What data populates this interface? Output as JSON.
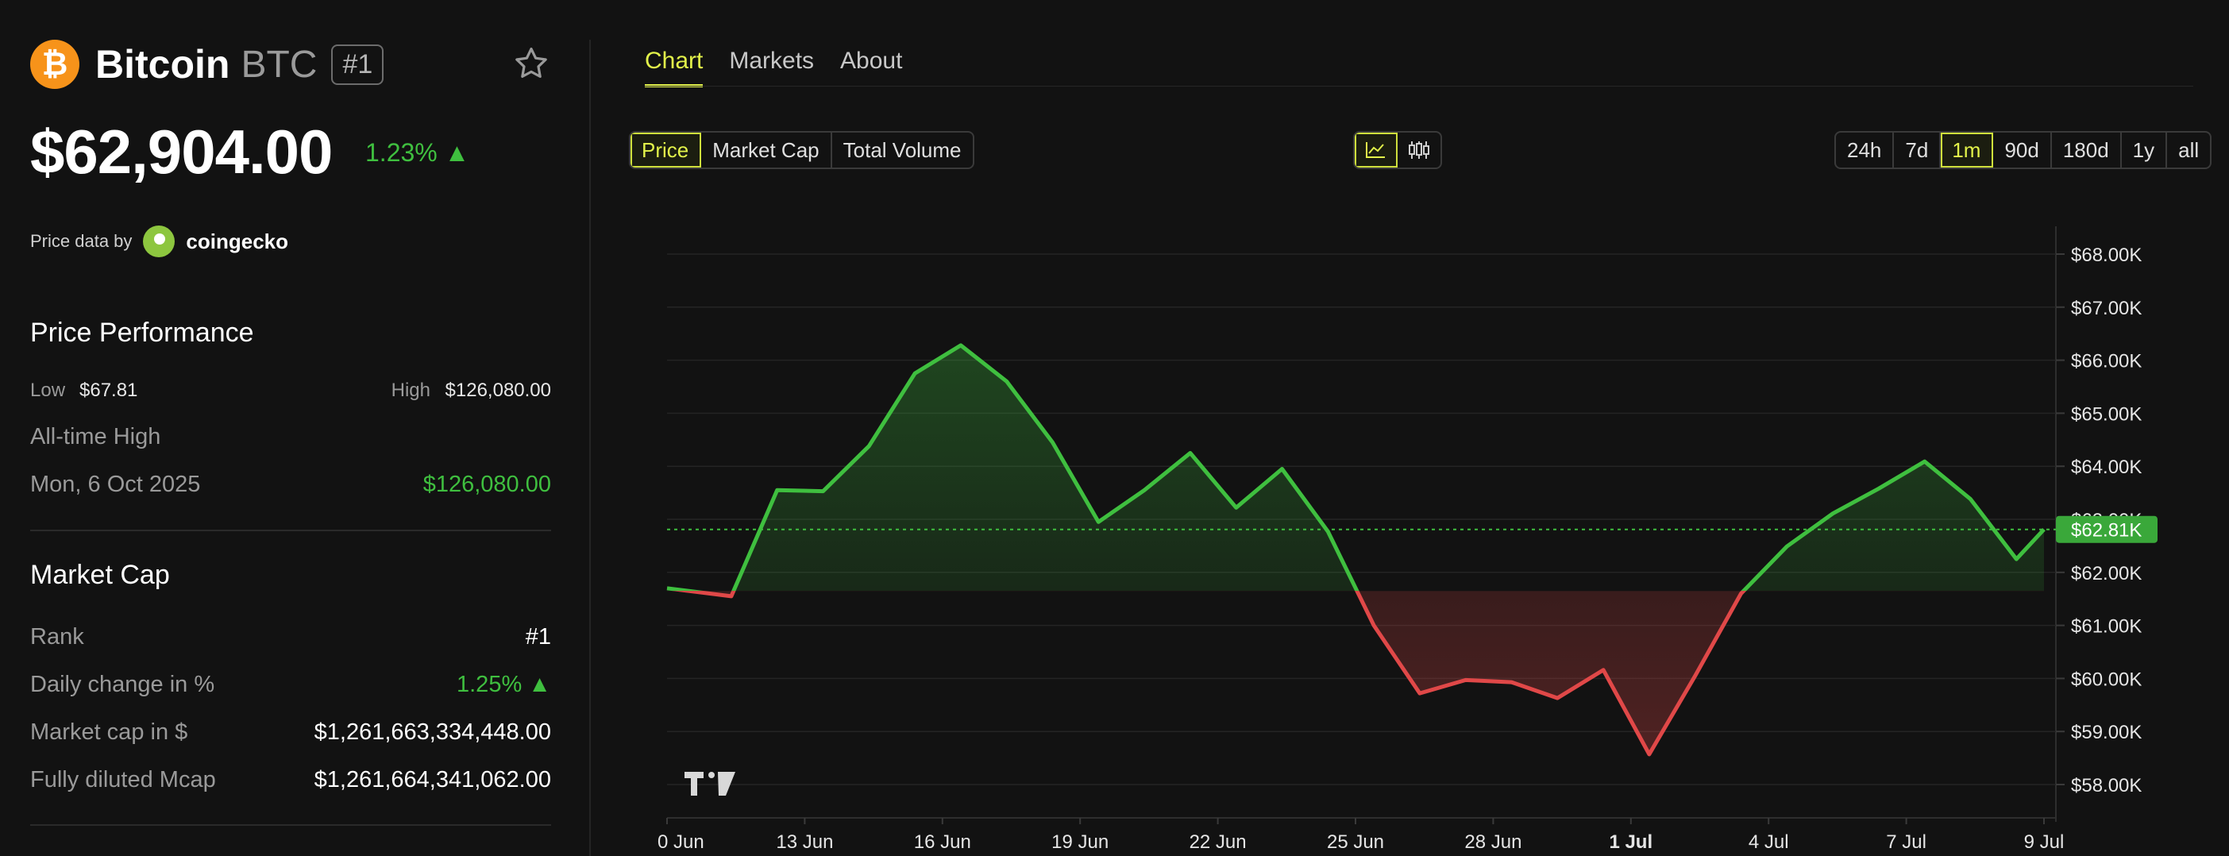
{
  "coin": {
    "icon": "bitcoin-icon",
    "icon_glyph": "₿",
    "name": "Bitcoin",
    "symbol": "BTC",
    "rank_badge": "#1"
  },
  "price": {
    "value": "$62,904.00",
    "change": "1.23% ▲"
  },
  "price_data": {
    "by_label": "Price data by",
    "source": "coingecko"
  },
  "performance": {
    "title": "Price Performance",
    "low_label": "Low",
    "low_value": "$67.81",
    "high_label": "High",
    "high_value": "$126,080.00",
    "ath_label": "All-time High",
    "ath_date": "Mon, 6 Oct 2025",
    "ath_value": "$126,080.00"
  },
  "market_cap": {
    "title": "Market Cap",
    "rows": [
      {
        "label": "Rank",
        "value": "#1"
      },
      {
        "label": "Daily change in %",
        "value": "1.25% ▲"
      },
      {
        "label": "Market cap in $",
        "value": "$1,261,663,334,448.00"
      },
      {
        "label": "Fully diluted Mcap",
        "value": "$1,261,664,341,062.00"
      }
    ]
  },
  "tabs": [
    "Chart",
    "Markets",
    "About"
  ],
  "active_tab": "Chart",
  "metric_buttons": [
    "Price",
    "Market Cap",
    "Total Volume"
  ],
  "active_metric": "Price",
  "chart_type_buttons": [
    "line-chart-icon",
    "candlestick-icon"
  ],
  "ranges": [
    "24h",
    "7d",
    "1m",
    "90d",
    "180d",
    "1y",
    "all"
  ],
  "active_range": "1m",
  "colors": {
    "accent": "#e2f24a",
    "up": "#3fbf3f",
    "down": "#e04848",
    "bg": "#121212"
  },
  "chart_data": {
    "type": "area",
    "ylim": [
      57500,
      68500
    ],
    "yticks": [
      58000,
      59000,
      60000,
      61000,
      62000,
      63000,
      64000,
      65000,
      66000,
      67000,
      68000
    ],
    "ytick_labels": [
      "$58.00K",
      "$59.00K",
      "$60.00K",
      "$61.00K",
      "$62.00K",
      "$63.00K",
      "$64.00K",
      "$65.00K",
      "$66.00K",
      "$67.00K",
      "$68.00K"
    ],
    "baseline": 61650,
    "current_price": 62810,
    "current_price_label": "$62.81K",
    "xtick_labels": [
      "0 Jun",
      "13 Jun",
      "16 Jun",
      "19 Jun",
      "22 Jun",
      "25 Jun",
      "28 Jun",
      "1 Jul",
      "4 Jul",
      "7 Jul",
      "9 Jul"
    ],
    "xtick_at": [
      0.0,
      3.0,
      6.0,
      9.0,
      12.0,
      15.0,
      18.0,
      21.0,
      24.0,
      27.0,
      30.0
    ],
    "xtick_bold": [
      false,
      false,
      false,
      false,
      false,
      false,
      false,
      true,
      false,
      false,
      false
    ],
    "x": [
      0,
      1.4,
      2.4,
      3.4,
      4.4,
      5.4,
      6.4,
      7.4,
      8.4,
      9.4,
      10.4,
      11.4,
      12.4,
      13.4,
      14.4,
      15.4,
      16.4,
      17.4,
      18.4,
      19.4,
      20.4,
      21.4,
      22.4,
      23.4,
      24.4,
      25.4,
      26.4,
      27.4,
      28.4,
      29.4,
      30.0
    ],
    "values": [
      61700,
      61550,
      63550,
      63530,
      64380,
      65750,
      66280,
      65600,
      64450,
      62950,
      63550,
      64250,
      63220,
      63950,
      62770,
      61000,
      59720,
      59970,
      59930,
      59630,
      60160,
      58570,
      60050,
      61600,
      62490,
      63110,
      63580,
      64090,
      63380,
      62250,
      62810
    ]
  }
}
